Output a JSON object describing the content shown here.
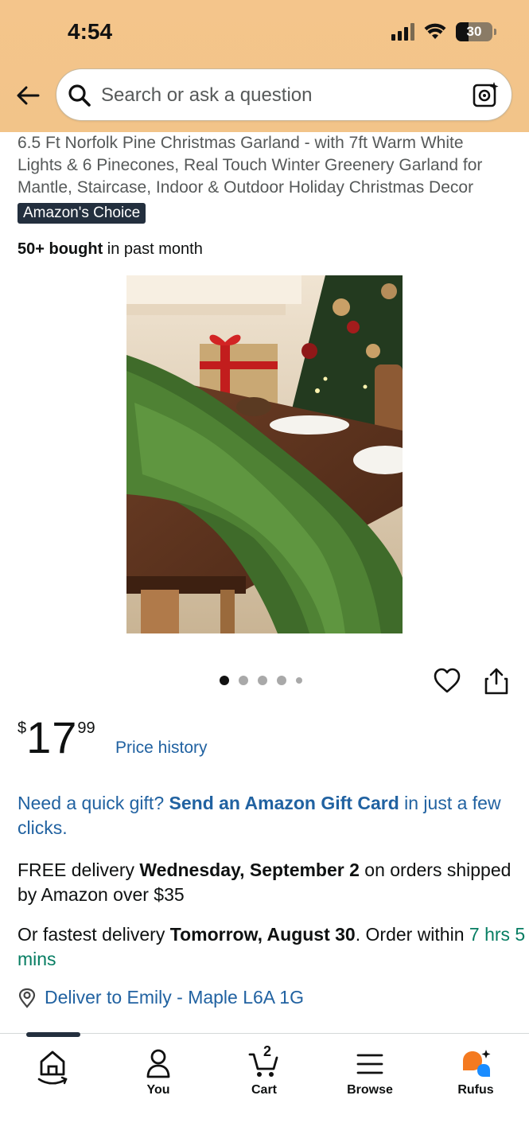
{
  "status_bar": {
    "time": "4:54",
    "battery": "30"
  },
  "search": {
    "placeholder": "Search or ask a question"
  },
  "product": {
    "title": "6.5 Ft Norfolk Pine Christmas Garland - with 7ft Warm White Lights & 6 Pinecones, Real Touch Winter Greenery Garland for Mantle, Staircase, Indoor & Outdoor Holiday Christmas Decor",
    "badge": "Amazon's Choice",
    "bought_bold": "50+ bought",
    "bought_rest": " in past month",
    "image_count": 5,
    "image_active_index": 0
  },
  "price": {
    "symbol": "$",
    "whole": "17",
    "fraction": "99",
    "history_link": "Price history"
  },
  "gift": {
    "prefix": "Need a quick gift? ",
    "link": "Send an Amazon Gift Card",
    "suffix": " in just a few clicks."
  },
  "delivery": {
    "prefix": "FREE delivery ",
    "date": "Wednesday, September 2",
    "suffix": " on orders shipped by Amazon over $35"
  },
  "fastest": {
    "prefix": "Or fastest delivery ",
    "date": "Tomorrow, August 30",
    "middle": ". Order within ",
    "countdown": "7 hrs 5 mins"
  },
  "deliver_to": {
    "text": "Deliver to Emily - Maple L6A 1G"
  },
  "bottom_nav": {
    "you": "You",
    "cart": "Cart",
    "cart_count": "2",
    "browse": "Browse",
    "rufus": "Rufus"
  },
  "colors": {
    "header_bg": "#f4c58b",
    "link": "#2162a1",
    "countdown": "#067d62",
    "badge_bg": "#232f3e",
    "rufus_orange": "#f47a20",
    "rufus_blue": "#1a8cff"
  }
}
